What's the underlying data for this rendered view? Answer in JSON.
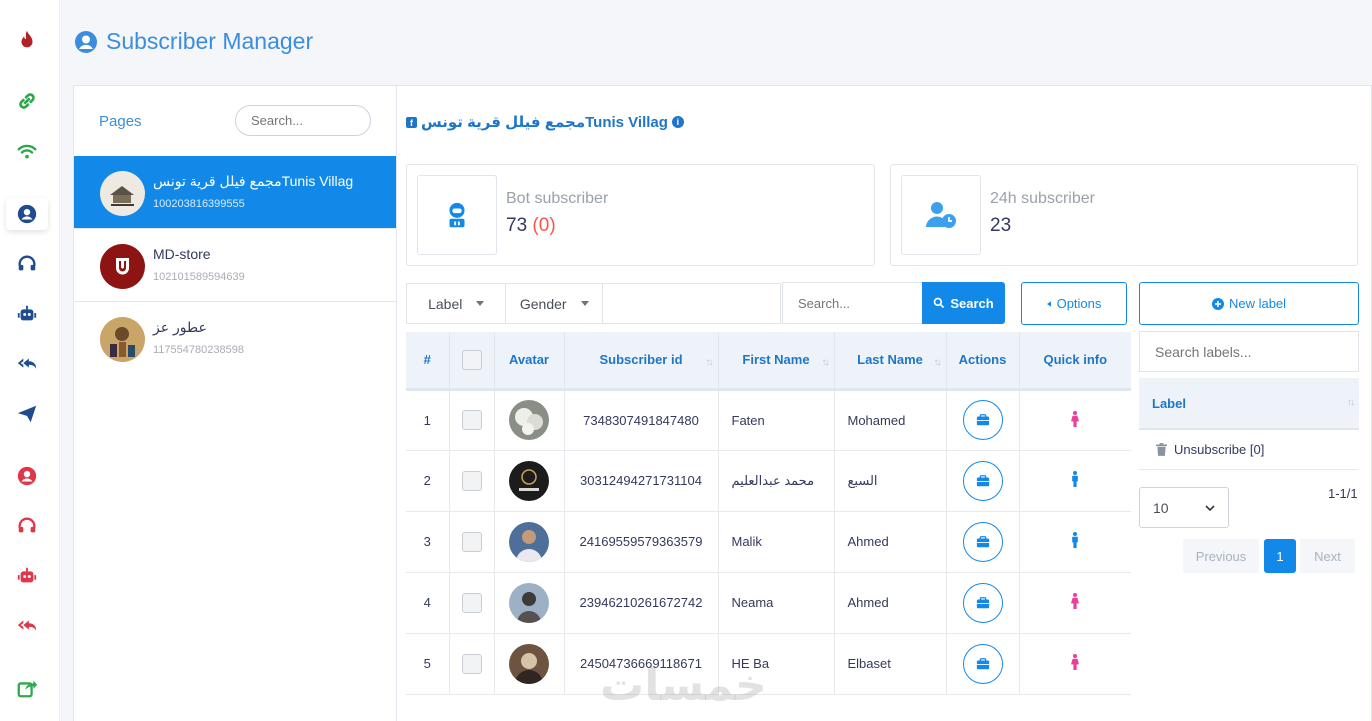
{
  "app": {
    "title": "Subscriber Manager",
    "accent_color": "#1289e8",
    "watermark": "خمسات"
  },
  "rail": {
    "icons": [
      "fire-icon",
      "link-icon",
      "wifi-icon",
      "user-circle-icon",
      "headset-icon",
      "robot-icon",
      "reply-all-icon",
      "send-icon",
      "user-circle-red-icon",
      "headset-red-icon",
      "robot-red-icon",
      "reply-all-red-icon",
      "share-icon"
    ],
    "active": "user-circle-icon"
  },
  "pages": {
    "heading": "Pages",
    "search_placeholder": "Search...",
    "items": [
      {
        "name": "مجمع فيلل قرية تونسTunis Villag",
        "id": "100203816399555",
        "active": true
      },
      {
        "name": "MD-store",
        "id": "102101589594639",
        "active": false
      },
      {
        "name": "عطور عز",
        "id": "117554780238598",
        "active": false
      }
    ]
  },
  "main": {
    "page_title": "مجمع فيلل قرية تونسTunis Villag",
    "fb_glyph": "f",
    "info_glyph": "i",
    "stats": [
      {
        "label": "Bot subscriber",
        "value": "73",
        "extra": "(0)"
      },
      {
        "label": "24h subscriber",
        "value": "23"
      }
    ],
    "filters": {
      "label": "Label",
      "gender": "Gender",
      "search_placeholder": "Search...",
      "search_button": "Search",
      "options_button": "Options"
    },
    "table": {
      "headers": [
        "#",
        "",
        "Avatar",
        "Subscriber id",
        "First Name",
        "Last Name",
        "Actions",
        "Quick info"
      ],
      "rows": [
        {
          "n": "1",
          "id": "7348307491847480",
          "first": "Faten",
          "last": "Mohamed",
          "gender": "female"
        },
        {
          "n": "2",
          "id": "30312494271731104",
          "first": "محمد عبدالعليم",
          "last": "السبع",
          "gender": "male"
        },
        {
          "n": "3",
          "id": "24169559579363579",
          "first": "Malik",
          "last": "Ahmed",
          "gender": "male"
        },
        {
          "n": "4",
          "id": "23946210261672742",
          "first": "Neama",
          "last": "Ahmed",
          "gender": "female"
        },
        {
          "n": "5",
          "id": "24504736669118671",
          "first": "HE Ba",
          "last": "Elbaset",
          "gender": "female"
        }
      ]
    }
  },
  "labels": {
    "new_button": "New label",
    "search_placeholder": "Search labels...",
    "header": "Label",
    "items": [
      "Unsubscribe [0]"
    ],
    "page_size": "10",
    "range": "1-1/1",
    "prev": "Previous",
    "current": "1",
    "next": "Next"
  }
}
